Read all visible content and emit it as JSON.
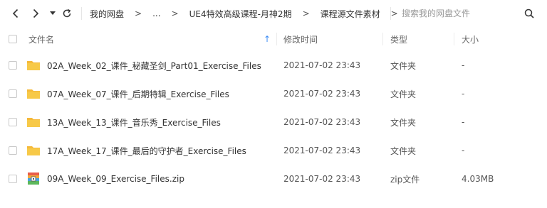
{
  "toolbar": {
    "breadcrumbs": [
      "我的网盘",
      "...",
      "UE4特效高级课程-月神2期",
      "课程源文件素材"
    ],
    "breadcrumb_separator": ">",
    "search_placeholder": "搜索我的网盘文件"
  },
  "columns": {
    "name": "文件名",
    "modified": "修改时间",
    "type": "类型",
    "size": "大小",
    "sort_indicator": "↑"
  },
  "files": [
    {
      "name": "02A_Week_02_课件_秘藏圣剑_Part01_Exercise_Files",
      "modified": "2021-07-02 23:43",
      "type": "文件夹",
      "size": "-",
      "icon": "folder-icon"
    },
    {
      "name": "07A_Week_07_课件_后期特辑_Exercise_Files",
      "modified": "2021-07-02 23:43",
      "type": "文件夹",
      "size": "-",
      "icon": "folder-icon"
    },
    {
      "name": "13A_Week_13_课件_音乐秀_Exercise_Files",
      "modified": "2021-07-02 23:43",
      "type": "文件夹",
      "size": "-",
      "icon": "folder-icon"
    },
    {
      "name": "17A_Week_17_课件_最后的守护者_Exercise_Files",
      "modified": "2021-07-02 23:43",
      "type": "文件夹",
      "size": "-",
      "icon": "folder-icon"
    },
    {
      "name": "09A_Week_09_Exercise_Files.zip",
      "modified": "2021-07-02 23:43",
      "type": "zip文件",
      "size": "4.03MB",
      "icon": "zip-archive-icon"
    }
  ],
  "colors": {
    "folder": "#f7c948",
    "sort_arrow": "#3b8cf5",
    "accent": "#06a7ff"
  }
}
